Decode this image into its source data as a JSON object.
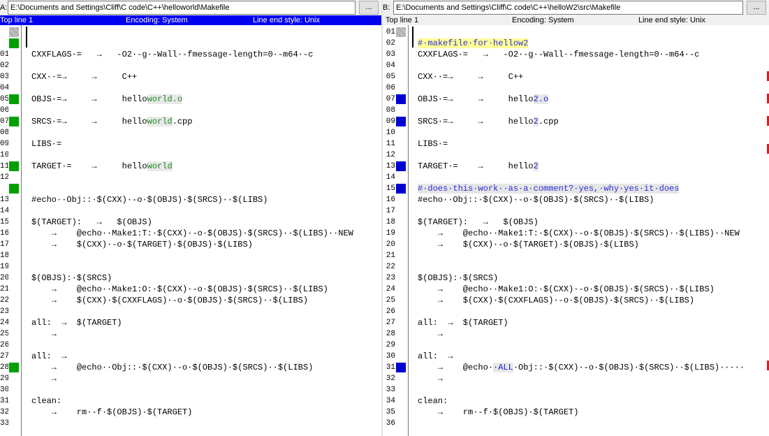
{
  "colors": {
    "added": "#00a000",
    "changed": "#0000d0",
    "active_status": "#0000ee",
    "diff_scroll_mark": "#d02020"
  },
  "icons": {
    "browse": "ellipsis-button",
    "marker_checker": "checker-icon"
  },
  "paneA": {
    "side": "A:",
    "path": "E:\\Documents and Settings\\Cliff\\C code\\C++\\helloworld\\Makefile",
    "browse": "...",
    "status": {
      "top": "Top line 1",
      "encoding": "Encoding: System",
      "lineend": "Line end style: Unix"
    },
    "lines": [
      {
        "n": "",
        "m": "checker",
        "t": ""
      },
      {
        "n": "",
        "m": "green",
        "t": ""
      },
      {
        "n": "01",
        "m": "",
        "t": "CXXFLAGS·=   →   -O2·-g·-Wall·-fmessage-length=0·-m64·-c"
      },
      {
        "n": "02",
        "m": "",
        "t": ""
      },
      {
        "n": "03",
        "m": "",
        "t": "CXX··=→     →     C++"
      },
      {
        "n": "04",
        "m": "",
        "t": ""
      },
      {
        "n": "05",
        "m": "green",
        "t": "OBJS·=→     →     hello",
        "h": "world.o",
        "c": "g"
      },
      {
        "n": "06",
        "m": "",
        "t": ""
      },
      {
        "n": "07",
        "m": "green",
        "t": "SRCS·=→     →     hello",
        "h": "world",
        "a": ".cpp",
        "c": "g"
      },
      {
        "n": "08",
        "m": "",
        "t": ""
      },
      {
        "n": "09",
        "m": "",
        "t": "LIBS·="
      },
      {
        "n": "10",
        "m": "",
        "t": ""
      },
      {
        "n": "11",
        "m": "green",
        "t": "TARGET·=    →     hello",
        "h": "world",
        "c": "g"
      },
      {
        "n": "12",
        "m": "",
        "t": ""
      },
      {
        "n": "",
        "m": "green",
        "t": ""
      },
      {
        "n": "13",
        "m": "",
        "t": "#echo··Obj::·$(CXX)·-o·$(OBJS)·$(SRCS)··$(LIBS)"
      },
      {
        "n": "14",
        "m": "",
        "t": ""
      },
      {
        "n": "15",
        "m": "",
        "t": "$(TARGET):   →   $(OBJS)"
      },
      {
        "n": "16",
        "m": "",
        "t": "    →    @echo··Make1:T:·$(CXX)·-o·$(OBJS)·$(SRCS)··$(LIBS)··NEW"
      },
      {
        "n": "17",
        "m": "",
        "t": "    →    $(CXX)·-o·$(TARGET)·$(OBJS)·$(LIBS)"
      },
      {
        "n": "18",
        "m": "",
        "t": ""
      },
      {
        "n": "19",
        "m": "",
        "t": ""
      },
      {
        "n": "20",
        "m": "",
        "t": "$(OBJS):·$(SRCS)"
      },
      {
        "n": "21",
        "m": "",
        "t": "    →    @echo··Make1:O:·$(CXX)·-o·$(OBJS)·$(SRCS)··$(LIBS)"
      },
      {
        "n": "22",
        "m": "",
        "t": "    →    $(CXX)·$(CXXFLAGS)·-o·$(OBJS)·$(SRCS)··$(LIBS)"
      },
      {
        "n": "23",
        "m": "",
        "t": ""
      },
      {
        "n": "24",
        "m": "",
        "t": "all:  →  $(TARGET)"
      },
      {
        "n": "25",
        "m": "",
        "t": "    →"
      },
      {
        "n": "26",
        "m": "",
        "t": ""
      },
      {
        "n": "27",
        "m": "",
        "t": "all:  →"
      },
      {
        "n": "28",
        "m": "green",
        "t": "    →    @echo··Obj::·$(CXX)·-o·$(OBJS)·$(SRCS)··$(LIBS)"
      },
      {
        "n": "29",
        "m": "",
        "t": "    →"
      },
      {
        "n": "30",
        "m": "",
        "t": ""
      },
      {
        "n": "31",
        "m": "",
        "t": "clean:"
      },
      {
        "n": "32",
        "m": "",
        "t": "    →    rm·-f·$(OBJS)·$(TARGET)"
      },
      {
        "n": "33",
        "m": "",
        "t": ""
      }
    ]
  },
  "paneB": {
    "side": "B:",
    "path": "E:\\Documents and Settings\\Cliff\\C code\\C++\\helloW2\\src\\Makefile",
    "browse": "...",
    "status": {
      "top": "Top line 1",
      "encoding": "Encoding: System",
      "lineend": "Line end style: Unix"
    },
    "lines": [
      {
        "n": "01",
        "m": "checker",
        "t": ""
      },
      {
        "n": "02",
        "m": "",
        "t": "",
        "h": "#·makefile·for·hellow2",
        "c": "fy"
      },
      {
        "n": "03",
        "m": "",
        "t": "CXXFLAGS·=   →   -O2·-g·-Wall·-fmessage-length=0·-m64·-c"
      },
      {
        "n": "04",
        "m": "",
        "t": ""
      },
      {
        "n": "05",
        "m": "",
        "t": "CXX··=→     →     C++"
      },
      {
        "n": "06",
        "m": "",
        "t": ""
      },
      {
        "n": "07",
        "m": "blue",
        "t": "OBJS·=→     →     hello",
        "h": "2.o",
        "c": "b"
      },
      {
        "n": "08",
        "m": "",
        "t": ""
      },
      {
        "n": "09",
        "m": "blue",
        "t": "SRCS·=→     →     hello",
        "h": "2",
        "a": ".cpp",
        "c": "b"
      },
      {
        "n": "10",
        "m": "",
        "t": ""
      },
      {
        "n": "11",
        "m": "",
        "t": "LIBS·="
      },
      {
        "n": "12",
        "m": "",
        "t": ""
      },
      {
        "n": "13",
        "m": "blue",
        "t": "TARGET·=    →     hello",
        "h": "2",
        "c": "b"
      },
      {
        "n": "14",
        "m": "",
        "t": ""
      },
      {
        "n": "15",
        "m": "blue",
        "t": "",
        "h": "#·does·this·work··as·a·comment?·yes,·why·yes·it·does",
        "c": "fg"
      },
      {
        "n": "16",
        "m": "",
        "t": "#echo··Obj::·$(CXX)·-o·$(OBJS)·$(SRCS)··$(LIBS)"
      },
      {
        "n": "17",
        "m": "",
        "t": ""
      },
      {
        "n": "18",
        "m": "",
        "t": "$(TARGET):   →   $(OBJS)"
      },
      {
        "n": "19",
        "m": "",
        "t": "    →    @echo··Make1:T:·$(CXX)·-o·$(OBJS)·$(SRCS)··$(LIBS)··NEW"
      },
      {
        "n": "20",
        "m": "",
        "t": "    →    $(CXX)·-o·$(TARGET)·$(OBJS)·$(LIBS)"
      },
      {
        "n": "21",
        "m": "",
        "t": ""
      },
      {
        "n": "22",
        "m": "",
        "t": ""
      },
      {
        "n": "23",
        "m": "",
        "t": "$(OBJS):·$(SRCS)"
      },
      {
        "n": "24",
        "m": "",
        "t": "    →    @echo··Make1:O:·$(CXX)·-o·$(OBJS)·$(SRCS)··$(LIBS)"
      },
      {
        "n": "25",
        "m": "",
        "t": "    →    $(CXX)·$(CXXFLAGS)·-o·$(OBJS)·$(SRCS)··$(LIBS)"
      },
      {
        "n": "26",
        "m": "",
        "t": ""
      },
      {
        "n": "27",
        "m": "",
        "t": "all:  →  $(TARGET)"
      },
      {
        "n": "28",
        "m": "",
        "t": "    →"
      },
      {
        "n": "29",
        "m": "",
        "t": ""
      },
      {
        "n": "30",
        "m": "",
        "t": "all:  →"
      },
      {
        "n": "31",
        "m": "blue",
        "t": "    →    @echo·",
        "h": "·ALL",
        "a": "·Obj::·$(CXX)·-o·$(OBJS)·$(SRCS)··$(LIBS)·····",
        "c": "b"
      },
      {
        "n": "32",
        "m": "",
        "t": "    →"
      },
      {
        "n": "33",
        "m": "",
        "t": ""
      },
      {
        "n": "34",
        "m": "",
        "t": "clean:"
      },
      {
        "n": "35",
        "m": "",
        "t": "    →    rm·-f·$(OBJS)·$(TARGET)"
      },
      {
        "n": "36",
        "m": "",
        "t": ""
      }
    ]
  }
}
